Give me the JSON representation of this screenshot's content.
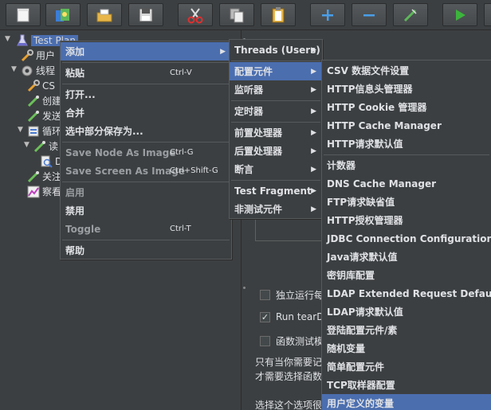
{
  "tree": {
    "items": [
      {
        "label": "Test Plan",
        "icon": "test-plan-icon"
      },
      {
        "label": "用户",
        "icon": "wrench-icon"
      },
      {
        "label": "线程",
        "icon": "gear-icon"
      },
      {
        "label": "CS",
        "icon": "wrench-icon"
      },
      {
        "label": "创建",
        "icon": "pipette-icon"
      },
      {
        "label": "发送",
        "icon": "pipette-icon"
      },
      {
        "label": "循环",
        "icon": "loop-icon"
      },
      {
        "label": "读",
        "icon": "pipette-icon"
      },
      {
        "label": "D",
        "icon": "search-icon"
      },
      {
        "label": "关注",
        "icon": "pipette-icon"
      },
      {
        "label": "察看",
        "icon": "graph-icon"
      }
    ]
  },
  "context_menu": {
    "items": [
      {
        "label": "添加",
        "shortcut": "",
        "submenu": "▶"
      },
      {
        "label": "粘贴",
        "shortcut": "Ctrl-V"
      },
      {
        "label": "打开...",
        "shortcut": ""
      },
      {
        "label": "合并",
        "shortcut": ""
      },
      {
        "label": "选中部分保存为...",
        "shortcut": ""
      },
      {
        "label": "Save Node As Image",
        "shortcut": "Ctrl-G"
      },
      {
        "label": "Save Screen As Image",
        "shortcut": "Ctrl+Shift-G"
      },
      {
        "label": "启用",
        "shortcut": ""
      },
      {
        "label": "禁用",
        "shortcut": ""
      },
      {
        "label": "Toggle",
        "shortcut": "Ctrl-T"
      },
      {
        "label": "帮助",
        "shortcut": ""
      }
    ]
  },
  "add_menu": {
    "items": [
      {
        "label": "Threads (Users)",
        "submenu": "▶"
      },
      {
        "label": "配置元件",
        "submenu": "▶"
      },
      {
        "label": "监听器",
        "submenu": "▶"
      },
      {
        "label": "定时器",
        "submenu": "▶"
      },
      {
        "label": "前置处理器",
        "submenu": "▶"
      },
      {
        "label": "后置处理器",
        "submenu": "▶"
      },
      {
        "label": "断言",
        "submenu": "▶"
      },
      {
        "label": "Test Fragment",
        "submenu": "▶"
      },
      {
        "label": "非测试元件",
        "submenu": "▶"
      }
    ]
  },
  "config_menu": {
    "items": [
      {
        "label": "CSV 数据文件设置"
      },
      {
        "label": "HTTP信息头管理器"
      },
      {
        "label": "HTTP Cookie 管理器"
      },
      {
        "label": "HTTP Cache Manager"
      },
      {
        "label": "HTTP请求默认值"
      },
      {
        "label": "计数器"
      },
      {
        "label": "DNS Cache Manager"
      },
      {
        "label": "FTP请求缺省值"
      },
      {
        "label": "HTTP授权管理器"
      },
      {
        "label": "JDBC Connection Configuration"
      },
      {
        "label": "Java请求默认值"
      },
      {
        "label": "密钥库配置"
      },
      {
        "label": "LDAP Extended Request Defaults"
      },
      {
        "label": "LDAP请求默认值"
      },
      {
        "label": "登陆配置元件/素"
      },
      {
        "label": "随机变量"
      },
      {
        "label": "简单配置元件"
      },
      {
        "label": "TCP取样器配置"
      },
      {
        "label": "用户定义的变量"
      }
    ]
  },
  "right_panel": {
    "chk1": "独立运行每",
    "chk2": "Run tearDo",
    "chk3": "函数测试模",
    "chk2_mark": "✓",
    "note1": "只有当你需要记",
    "note2": "才需要选择函数",
    "note3": "选择这个选项很"
  },
  "colors": {
    "highlight": "#4b6eaf",
    "background": "#3c3f41"
  }
}
